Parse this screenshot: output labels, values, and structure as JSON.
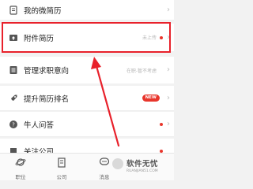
{
  "menu": {
    "items": [
      {
        "label": "我的微简历",
        "status": "",
        "icon": "document-icon"
      },
      {
        "label": "附件简历",
        "status": "未上传",
        "icon": "upload-folder-icon"
      },
      {
        "label": "管理求职意向",
        "status": "在职-暂不考虑",
        "icon": "list-icon"
      },
      {
        "label": "提升简历排名",
        "status": "",
        "icon": "rocket-icon",
        "badge": "NEW"
      },
      {
        "label": "牛人问答",
        "status": "",
        "icon": "question-icon"
      },
      {
        "label": "关注公司",
        "status": "",
        "icon": "company-icon"
      }
    ],
    "chevron": "›"
  },
  "highlight_color": "#e8212b",
  "tabbar": {
    "tabs": [
      {
        "label": "职位",
        "icon": "planet-icon"
      },
      {
        "label": "公司",
        "icon": "building-icon"
      },
      {
        "label": "消息",
        "icon": "chat-icon"
      }
    ]
  },
  "watermark": {
    "title": "软件无忧",
    "subtitle": "RUANJIAN51.COM"
  }
}
